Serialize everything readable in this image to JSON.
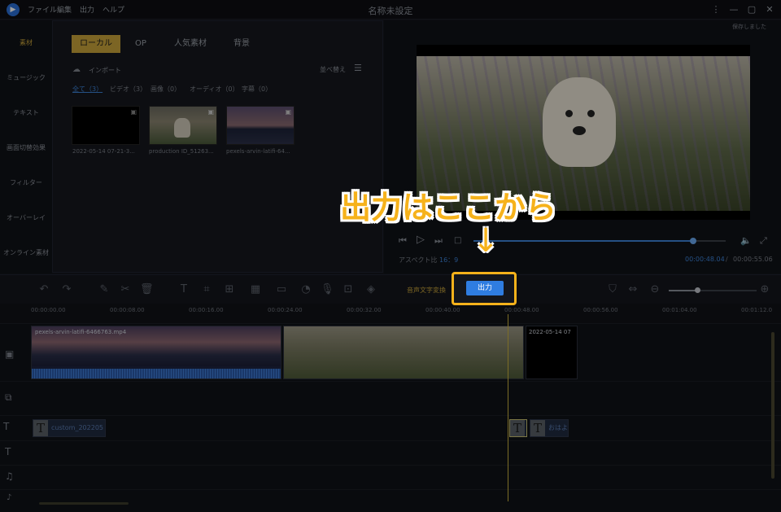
{
  "app": {
    "title": "名称未設定",
    "saved_status": "保存しました"
  },
  "menu": [
    "ファイル",
    "編集",
    "出力",
    "ヘルプ"
  ],
  "nav": [
    "素材",
    "ミュージック",
    "テキスト",
    "画面切替効果",
    "フィルター",
    "オーバーレイ",
    "オンライン素材"
  ],
  "library": {
    "tabs": [
      "ローカル",
      "OP",
      "人気素材",
      "背景"
    ],
    "import_label": "インポート",
    "sort_label": "並べ替え",
    "filters": [
      "全て（3）",
      "ビデオ（3）",
      "画像（0）",
      "オーディオ（0）",
      "字幕（0）"
    ],
    "media": [
      {
        "caption": "2022-05-14 07-21-3..."
      },
      {
        "caption": "production ID_51263..."
      },
      {
        "caption": "pexels-arvin-latifi-64..."
      }
    ]
  },
  "preview": {
    "aspect_label": "アスペクト比",
    "aspect_value": "16：9",
    "current_time": "00:00:48.04",
    "separator": "/",
    "total_time": "00:00:55.06",
    "progress": 0.87
  },
  "toolbar": {
    "speech_to_text": "音声文字変換",
    "export": "出力"
  },
  "ruler": [
    "00:00:00.00",
    "00:00:08.00",
    "00:00:16.00",
    "00:00:24.00",
    "00:00:32.00",
    "00:00:40.00",
    "00:00:48.00",
    "00:00:56.00",
    "00:01:04.00",
    "00:01:12.0"
  ],
  "timeline": {
    "video_clips": [
      "pexels-arvin-latifi-6466763.mp4",
      "2022-05-14 07"
    ],
    "text_clips": [
      "custom_202205",
      "おはよ"
    ]
  },
  "annotation": {
    "callout": "出力はここから",
    "arrow": "↓"
  },
  "colors": {
    "accent": "#c8a43b",
    "export": "#2f7de1",
    "highlight": "#f6b21b"
  }
}
